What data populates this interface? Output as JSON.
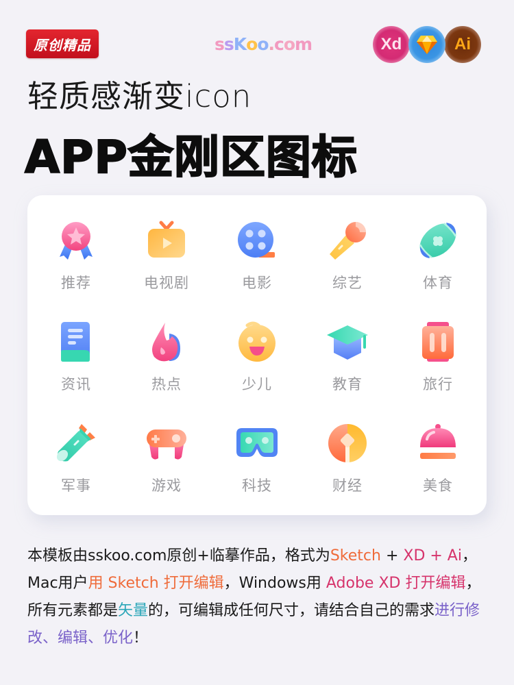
{
  "header": {
    "badge_label": "原创精品",
    "logo": {
      "letters": [
        {
          "ch": "s",
          "color": "#f29ac0"
        },
        {
          "ch": "s",
          "color": "#b99bf0"
        },
        {
          "ch": "K",
          "color": "#8fb2f8"
        },
        {
          "ch": "o",
          "color": "#ffc24a"
        },
        {
          "ch": "o",
          "color": "#8fb2f8"
        },
        {
          "ch": ".",
          "color": "#f2a0b6"
        },
        {
          "ch": "c",
          "color": "#f29ac0"
        },
        {
          "ch": "o",
          "color": "#f5a7c2"
        },
        {
          "ch": "m",
          "color": "#f29ac0"
        }
      ]
    },
    "tools": [
      {
        "name": "xd",
        "label": "Xd"
      },
      {
        "name": "sketch",
        "label": ""
      },
      {
        "name": "ai",
        "label": "Ai"
      }
    ]
  },
  "subtitle": "轻质感渐变icon",
  "title": "APP金刚区图标",
  "grid": {
    "items": [
      {
        "id": "recommend",
        "label": "推荐",
        "icon": "medal-icon"
      },
      {
        "id": "tv-series",
        "label": "电视剧",
        "icon": "tv-icon"
      },
      {
        "id": "movie",
        "label": "电影",
        "icon": "film-reel-icon"
      },
      {
        "id": "variety",
        "label": "综艺",
        "icon": "microphone-icon"
      },
      {
        "id": "sports",
        "label": "体育",
        "icon": "rugby-ball-icon"
      },
      {
        "id": "news",
        "label": "资讯",
        "icon": "document-icon"
      },
      {
        "id": "hot",
        "label": "热点",
        "icon": "flame-icon"
      },
      {
        "id": "kids",
        "label": "少儿",
        "icon": "baby-face-icon"
      },
      {
        "id": "education",
        "label": "教育",
        "icon": "graduation-cap-icon"
      },
      {
        "id": "travel",
        "label": "旅行",
        "icon": "suitcase-icon"
      },
      {
        "id": "military",
        "label": "军事",
        "icon": "missile-icon"
      },
      {
        "id": "games",
        "label": "游戏",
        "icon": "gamepad-icon"
      },
      {
        "id": "tech",
        "label": "科技",
        "icon": "vr-glasses-icon"
      },
      {
        "id": "finance",
        "label": "财经",
        "icon": "coin-icon"
      },
      {
        "id": "food",
        "label": "美食",
        "icon": "food-cloche-icon"
      }
    ]
  },
  "description": {
    "segments": [
      {
        "text": "本模板由sskoo.com原创+临摹作品，格式为",
        "style": ""
      },
      {
        "text": "Sketch",
        "style": "c-orange"
      },
      {
        "text": " + ",
        "style": ""
      },
      {
        "text": "XD + Ai",
        "style": "c-pink"
      },
      {
        "text": "，Mac用户",
        "style": ""
      },
      {
        "text": "用 Sketch 打开编辑",
        "style": "c-orange"
      },
      {
        "text": "，Windows用 ",
        "style": ""
      },
      {
        "text": "Adobe XD 打开编辑",
        "style": "c-pink"
      },
      {
        "text": "，所有元素都是",
        "style": ""
      },
      {
        "text": "矢量",
        "style": "c-teal"
      },
      {
        "text": "的，可编辑成任何尺寸，请结合自己的需求",
        "style": ""
      },
      {
        "text": "进行修改、编辑、优化",
        "style": "c-purple"
      },
      {
        "text": "！",
        "style": ""
      }
    ]
  },
  "colors": {
    "background": "#f3f2f7",
    "badge_red": "#d81b26",
    "label_gray": "#9a9a9e",
    "accent_orange": "#ef6b3a",
    "accent_pink": "#d6336b",
    "accent_teal": "#2aa6b8",
    "accent_purple": "#7a62c9"
  }
}
